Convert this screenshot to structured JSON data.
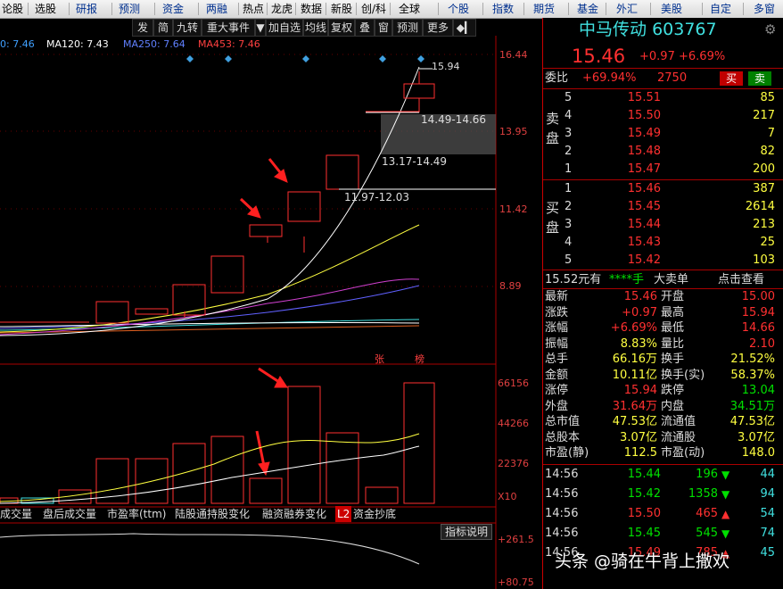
{
  "topbar": {
    "items": [
      "论股",
      "选股",
      "研报",
      "预测",
      "资金",
      "两融",
      "热点",
      "龙虎",
      "数据",
      "新股",
      "创/科",
      "全球",
      "个股",
      "指数",
      "期货",
      "基金",
      "外汇",
      "美股",
      "自定",
      "多窗"
    ]
  },
  "toolbar2": [
    "发",
    "简",
    "九转",
    "重大事件",
    "▼",
    "加自选",
    "均线",
    "复权",
    "叠",
    "窗",
    "预测",
    "更多",
    "◆▎"
  ],
  "ma_legend": [
    {
      "text": "0: 7.46",
      "color": "#40a0ff"
    },
    {
      "text": "MA120: 7.43",
      "color": "#ffffff"
    },
    {
      "text": "MA250: 7.64",
      "color": "#6080ff"
    },
    {
      "text": "MA453: 7.46",
      "color": "#ff4040"
    }
  ],
  "price_axis": [
    "16.44",
    "13.95",
    "11.42",
    "8.89"
  ],
  "volume_axis": [
    "66156",
    "44266",
    "22376",
    "X10"
  ],
  "indicator_axis": [
    "+261.5",
    "+80.75"
  ],
  "annotations": {
    "high": "15.94",
    "range1": "14.49-14.66",
    "range2": "13.17-14.49",
    "range3": "11.97-12.03"
  },
  "candle_marks": [
    "张",
    "榜"
  ],
  "tabs": [
    "成交量",
    "盘后成交量",
    "市盈率(ttm)",
    "陆股通持股变化",
    "融资融券变化",
    "L2",
    "资金抄底"
  ],
  "indicator_btn": "指标说明",
  "stock": {
    "name": "中马传动",
    "code": "603767",
    "price": "15.46",
    "change": "+0.97",
    "pct": "+6.69%"
  },
  "weibi": {
    "label": "委比",
    "ratio": "+69.94%",
    "diff": "2750",
    "buy": "买",
    "sell": "卖"
  },
  "sell_orders": [
    {
      "lvl": "5",
      "price": "15.51",
      "vol": "85"
    },
    {
      "lvl": "4",
      "price": "15.50",
      "vol": "217"
    },
    {
      "lvl": "3",
      "price": "15.49",
      "vol": "7"
    },
    {
      "lvl": "2",
      "price": "15.48",
      "vol": "82"
    },
    {
      "lvl": "1",
      "price": "15.47",
      "vol": "200"
    }
  ],
  "buy_orders": [
    {
      "lvl": "1",
      "price": "15.46",
      "vol": "387"
    },
    {
      "lvl": "2",
      "price": "15.45",
      "vol": "2614"
    },
    {
      "lvl": "3",
      "price": "15.44",
      "vol": "213"
    },
    {
      "lvl": "4",
      "price": "15.43",
      "vol": "25"
    },
    {
      "lvl": "5",
      "price": "15.42",
      "vol": "103"
    }
  ],
  "sell_label": [
    "卖",
    "盘"
  ],
  "buy_label": [
    "买",
    "盘"
  ],
  "big_order": {
    "price": "15.52元有",
    "stars": "****手",
    "label": "大卖单",
    "link": "点击查看"
  },
  "stats": [
    {
      "k1": "最新",
      "v1": "15.46",
      "k2": "开盘",
      "v2": "15.00"
    },
    {
      "k1": "涨跌",
      "v1": "+0.97",
      "k2": "最高",
      "v2": "15.94"
    },
    {
      "k1": "涨幅",
      "v1": "+6.69%",
      "k2": "最低",
      "v2": "14.66"
    },
    {
      "k1": "振幅",
      "v1": "8.83%",
      "k2": "量比",
      "v2": "2.10"
    },
    {
      "k1": "总手",
      "v1": "66.16万",
      "k2": "换手",
      "v2": "21.52%"
    },
    {
      "k1": "金额",
      "v1": "10.11亿",
      "k2": "换手(实)",
      "v2": "58.37%"
    },
    {
      "k1": "涨停",
      "v1": "15.94",
      "k2": "跌停",
      "v2": "13.04"
    },
    {
      "k1": "外盘",
      "v1": "31.64万",
      "k2": "内盘",
      "v2": "34.51万"
    },
    {
      "k1": "总市值",
      "v1": "47.53亿",
      "k2": "流通值",
      "v2": "47.53亿"
    },
    {
      "k1": "总股本",
      "v1": "3.07亿",
      "k2": "流通股",
      "v2": "3.07亿"
    },
    {
      "k1": "市盈(静)",
      "v1": "112.5",
      "k2": "市盈(动)",
      "v2": "148.0"
    }
  ],
  "ticks": [
    {
      "time": "14:56",
      "price": "15.44",
      "vol": "196",
      "dir": "down",
      "n": "44"
    },
    {
      "time": "14:56",
      "price": "15.42",
      "vol": "1358",
      "dir": "down",
      "n": "94"
    },
    {
      "time": "14:56",
      "price": "15.50",
      "vol": "465",
      "dir": "up",
      "n": "54"
    },
    {
      "time": "14:56",
      "price": "15.45",
      "vol": "545",
      "dir": "down",
      "n": "74"
    },
    {
      "time": "14:56",
      "price": "15.49",
      "vol": "785",
      "dir": "up",
      "n": "45"
    }
  ],
  "watermark": "头条 @骑在牛背上撒欢"
}
